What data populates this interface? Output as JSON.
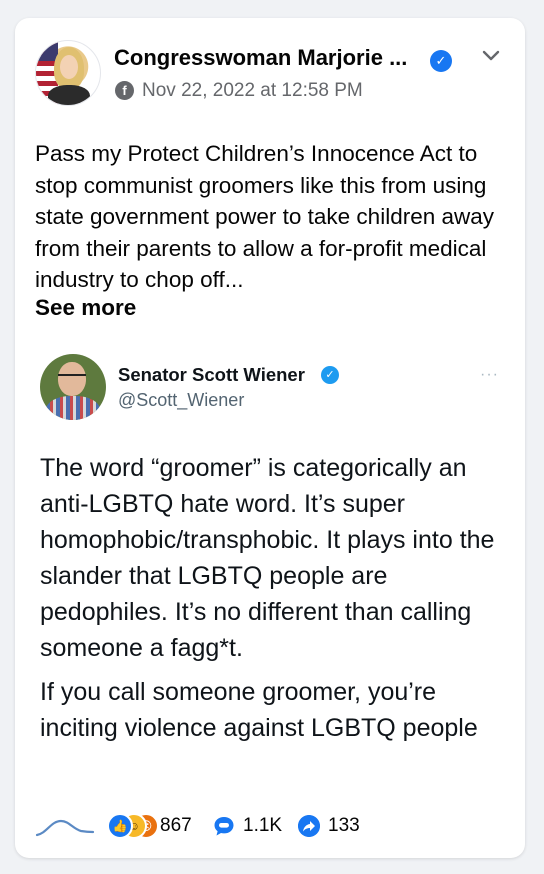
{
  "post": {
    "author": "Congresswoman Marjorie ...",
    "timestamp": "Nov 22, 2022 at 12:58 PM",
    "text": "Pass my Protect Children’s Innocence Act to stop communist groomers like this from using state government power to take children away from their parents to allow a for-profit medical industry to chop off...",
    "see_more": "See more"
  },
  "tweet": {
    "name": "Senator Scott Wiener",
    "handle": "@Scott_Wiener",
    "more": "···",
    "paragraphs": [
      "The word “groomer” is categorically an anti-LGBTQ hate word. It’s super homophobic/transphobic. It plays into the slander that LGBTQ people are pedophiles. It’s no different than calling someone a fagg*t.",
      "If you call someone groomer, you’re inciting violence against LGBTQ people"
    ]
  },
  "stats": {
    "reactions": "867",
    "comments": "1.1K",
    "shares": "133"
  },
  "icons": {
    "globe": "globe-icon",
    "verified": "verified-badge-icon",
    "chevron": "chevron-down-icon",
    "comment": "comment-icon",
    "share": "share-icon",
    "reactions": [
      "like-icon",
      "haha-icon",
      "angry-icon"
    ]
  },
  "colors": {
    "facebook_blue": "#1877f2",
    "twitter_blue": "#1d9bf0",
    "secondary_text": "#65676b"
  }
}
